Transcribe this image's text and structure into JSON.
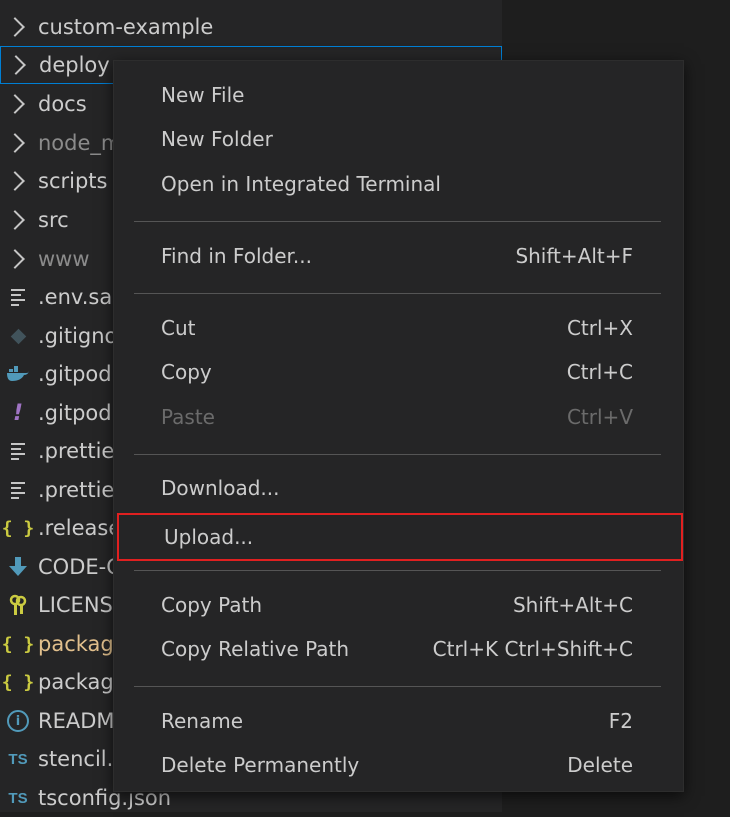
{
  "explorer": {
    "items": [
      {
        "label": "custom-example",
        "icon": "chevron-right-icon"
      },
      {
        "label": "deploy",
        "icon": "chevron-right-icon"
      },
      {
        "label": "docs",
        "icon": "chevron-right-icon"
      },
      {
        "label": "node_m",
        "icon": "chevron-right-icon"
      },
      {
        "label": "scripts",
        "icon": "chevron-right-icon"
      },
      {
        "label": "src",
        "icon": "chevron-right-icon"
      },
      {
        "label": "www",
        "icon": "chevron-right-icon"
      },
      {
        "label": ".env.sar",
        "icon": "text-file-icon"
      },
      {
        "label": ".gitigno",
        "icon": "git-icon"
      },
      {
        "label": ".gitpod.",
        "icon": "docker-icon"
      },
      {
        "label": ".gitpod.",
        "icon": "yaml-icon"
      },
      {
        "label": ".prettier",
        "icon": "text-file-icon"
      },
      {
        "label": ".prettier",
        "icon": "text-file-icon"
      },
      {
        "label": ".release",
        "icon": "json-icon"
      },
      {
        "label": "CODE-C",
        "icon": "download-arrow-icon"
      },
      {
        "label": "LICENSI",
        "icon": "license-key-icon"
      },
      {
        "label": "package",
        "icon": "json-icon"
      },
      {
        "label": "package",
        "icon": "json-icon"
      },
      {
        "label": "READM",
        "icon": "info-icon"
      },
      {
        "label": "stencil.c",
        "icon": "typescript-icon"
      },
      {
        "label": "tsconfig.json",
        "icon": "typescript-icon"
      }
    ],
    "ts_badge": "TS",
    "info_glyph": "i",
    "json_glyph": "{ }",
    "yaml_glyph": "!"
  },
  "context_menu": {
    "groups": [
      [
        {
          "label": "New File",
          "shortcut": ""
        },
        {
          "label": "New Folder",
          "shortcut": ""
        },
        {
          "label": "Open in Integrated Terminal",
          "shortcut": ""
        }
      ],
      [
        {
          "label": "Find in Folder...",
          "shortcut": "Shift+Alt+F"
        }
      ],
      [
        {
          "label": "Cut",
          "shortcut": "Ctrl+X"
        },
        {
          "label": "Copy",
          "shortcut": "Ctrl+C"
        },
        {
          "label": "Paste",
          "shortcut": "Ctrl+V",
          "disabled": true
        }
      ],
      [
        {
          "label": "Download...",
          "shortcut": ""
        },
        {
          "label": "Upload...",
          "shortcut": "",
          "highlighted": true
        }
      ],
      [
        {
          "label": "Copy Path",
          "shortcut": "Shift+Alt+C"
        },
        {
          "label": "Copy Relative Path",
          "shortcut": "Ctrl+K Ctrl+Shift+C"
        }
      ],
      [
        {
          "label": "Rename",
          "shortcut": "F2"
        },
        {
          "label": "Delete Permanently",
          "shortcut": "Delete"
        }
      ]
    ]
  },
  "colors": {
    "highlight_outline": "#e02020",
    "focus_border": "#007fd4",
    "menu_bg": "#252526",
    "text": "#cccccc"
  }
}
